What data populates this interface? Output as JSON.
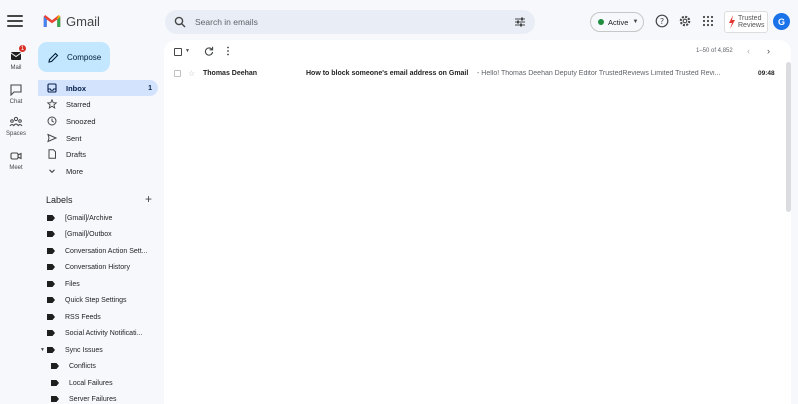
{
  "app": {
    "name": "Gmail"
  },
  "search": {
    "placeholder": "Search in emails"
  },
  "status": {
    "label": "Active",
    "color": "#1e8e3e"
  },
  "account": {
    "avatar_letter": "G",
    "brand_line1": "Trusted",
    "brand_line2": "Reviews"
  },
  "rail": {
    "items": [
      {
        "label": "Mail",
        "icon": "mail-icon",
        "badge": "1"
      },
      {
        "label": "Chat",
        "icon": "chat-icon"
      },
      {
        "label": "Spaces",
        "icon": "spaces-icon"
      },
      {
        "label": "Meet",
        "icon": "meet-icon"
      }
    ]
  },
  "sidebar": {
    "compose_label": "Compose",
    "nav": [
      {
        "label": "Inbox",
        "icon": "inbox-icon",
        "count": "1",
        "selected": true
      },
      {
        "label": "Starred",
        "icon": "star-icon"
      },
      {
        "label": "Snoozed",
        "icon": "clock-icon"
      },
      {
        "label": "Sent",
        "icon": "send-icon"
      },
      {
        "label": "Drafts",
        "icon": "draft-icon"
      },
      {
        "label": "More",
        "icon": "chevron-down-icon"
      }
    ],
    "labels_heading": "Labels",
    "labels": [
      {
        "label": "[Gmail]/Archive"
      },
      {
        "label": "[Gmail]/Outbox"
      },
      {
        "label": "Conversation Action Sett..."
      },
      {
        "label": "Conversation History"
      },
      {
        "label": "Files"
      },
      {
        "label": "Quick Step Settings"
      },
      {
        "label": "RSS Feeds"
      },
      {
        "label": "Social Activity Notificati..."
      },
      {
        "label": "Sync Issues",
        "expanded": true
      },
      {
        "label": "Conflicts",
        "sub": true
      },
      {
        "label": "Local Failures",
        "sub": true
      },
      {
        "label": "Server Failures",
        "sub": true
      }
    ]
  },
  "toolbar": {
    "range": "1–50 of 4,852"
  },
  "emails": [
    {
      "sender": "Thomas Deehan",
      "subject": "How to block someone's email address on Gmail",
      "snippet": "- Hello! Thomas Deehan Deputy Editor TrustedReviews Limited Trusted Revi...",
      "time": "09:48",
      "unread": true
    }
  ]
}
